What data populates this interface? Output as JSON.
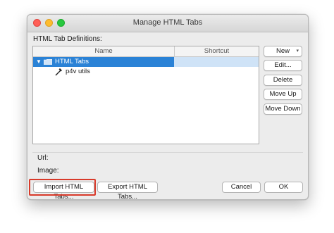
{
  "window": {
    "title": "Manage HTML Tabs"
  },
  "definitions_label": "HTML Tab Definitions:",
  "table": {
    "columns": [
      "Name",
      "Shortcut"
    ],
    "rows": [
      {
        "label": "HTML Tabs",
        "type": "folder",
        "expanded": true,
        "selected": true,
        "icon": "folder-icon"
      },
      {
        "label": "p4v utils",
        "type": "tool",
        "selected": false,
        "icon": "tool-icon"
      }
    ]
  },
  "side_buttons": {
    "new": "New",
    "edit": "Edit...",
    "delete": "Delete",
    "move_up": "Move Up",
    "move_down": "Move Down"
  },
  "fields": {
    "url_label": "Url:",
    "image_label": "Image:"
  },
  "footer": {
    "import": "Import HTML Tabs...",
    "export": "Export HTML Tabs...",
    "cancel": "Cancel",
    "ok": "OK"
  },
  "colors": {
    "selection": "#2a82d6",
    "highlight_annotation": "#d83a2a"
  }
}
